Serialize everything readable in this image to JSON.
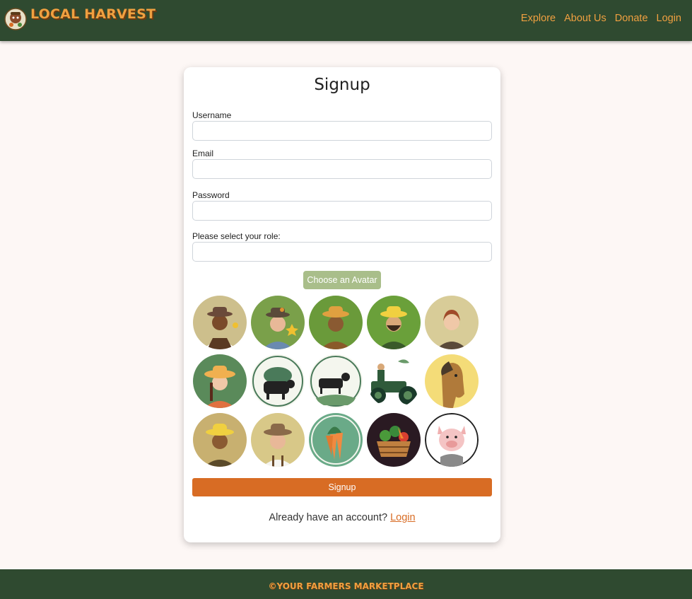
{
  "header": {
    "brand": "LOCAL HARVEST",
    "nav": [
      "Explore",
      "About Us",
      "Donate",
      "Login"
    ]
  },
  "form": {
    "title": "Signup",
    "username_label": "Username",
    "email_label": "Email",
    "password_label": "Password",
    "role_label": "Please select your role:",
    "avatar_button": "Choose an Avatar",
    "submit": "Signup",
    "already_text": "Already have an account?",
    "login_link": "Login"
  },
  "avatars": [
    "farmer-woman-brown-hat",
    "farmer-woman-green-hat",
    "farmer-woman-straw-hat",
    "farmer-man-beard",
    "farmer-woman-redhead",
    "farmer-girl-sunhat",
    "cow-emblem",
    "cow-field-emblem",
    "tractor-farmer",
    "horse",
    "farmer-yellow-hat",
    "farmer-man-brown-hat",
    "carrots",
    "vegetable-basket",
    "pig"
  ],
  "footer": {
    "text": "©YOUR FARMERS MARKETPLACE"
  },
  "colors": {
    "header_bg": "#2f4a30",
    "accent": "#f0a040",
    "submit": "#d86c24",
    "avatar_button": "#a9be8a",
    "page_bg": "#fdf7f5"
  }
}
